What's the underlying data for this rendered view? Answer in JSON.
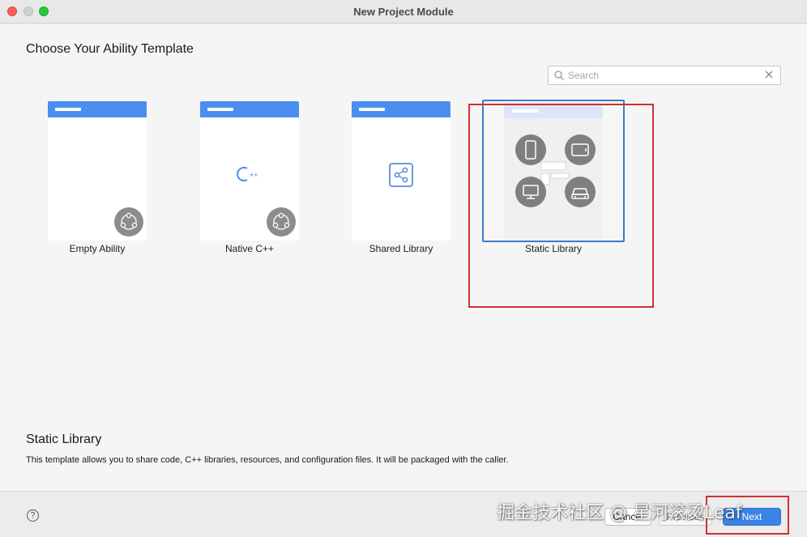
{
  "window": {
    "title": "New Project Module"
  },
  "heading": "Choose Your Ability Template",
  "search": {
    "placeholder": "Search",
    "value": ""
  },
  "templates": [
    {
      "label": "Empty Ability",
      "icon": "ability-icon"
    },
    {
      "label": "Native C++",
      "icon": "cpp-icon"
    },
    {
      "label": "Shared Library",
      "icon": "share-icon"
    },
    {
      "label": "Static Library",
      "icon": "devices-icon",
      "selected": true
    }
  ],
  "description": {
    "title": "Static Library",
    "text": "This template allows you to share code, C++ libraries, resources, and configuration files. It will be packaged with the caller."
  },
  "footer": {
    "help": "?",
    "cancel": "Cancel",
    "previous": "Previous",
    "next": "Next",
    "watermark": "掘金技术社区 @ 星河滚烫Leaf"
  },
  "colors": {
    "accent": "#4a8ff0",
    "selection": "#3d7cc9",
    "annotation": "#d32f2f",
    "primary_button": "#3b83e6"
  }
}
